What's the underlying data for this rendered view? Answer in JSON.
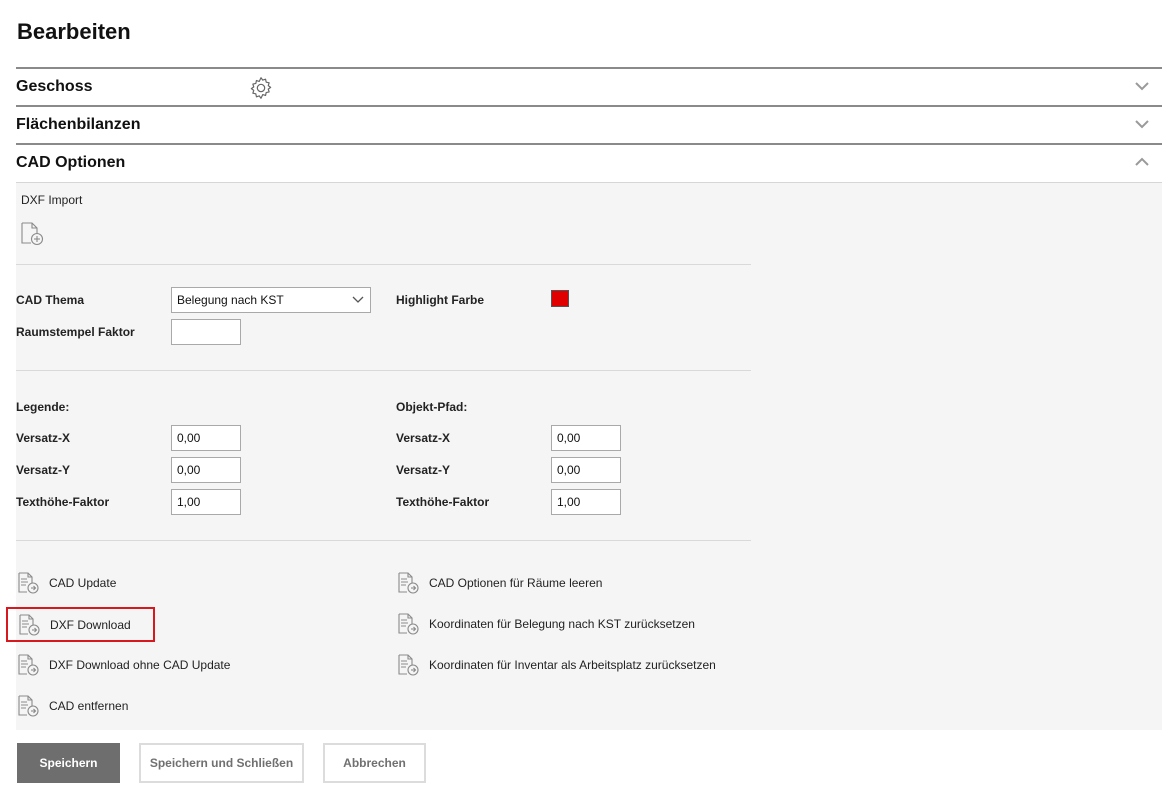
{
  "page": {
    "title": "Bearbeiten"
  },
  "accordion": [
    {
      "title": "Geschoss",
      "expanded": false,
      "icon": "gear-icon"
    },
    {
      "title": "Flächenbilanzen",
      "expanded": false
    },
    {
      "title": "CAD Optionen",
      "expanded": true
    }
  ],
  "cad": {
    "dxf_import_label": "DXF Import",
    "thema_label": "CAD Thema",
    "thema_value": "Belegung nach KST",
    "highlight_label": "Highlight Farbe",
    "highlight_color": "#e00000",
    "raumstempel_label": "Raumstempel Faktor",
    "raumstempel_value": "",
    "legende": {
      "title": "Legende:",
      "versatz_x_label": "Versatz-X",
      "versatz_x": "0,00",
      "versatz_y_label": "Versatz-Y",
      "versatz_y": "0,00",
      "texthoehe_label": "Texthöhe-Faktor",
      "texthoehe": "1,00"
    },
    "objekt": {
      "title": "Objekt-Pfad:",
      "versatz_x_label": "Versatz-X",
      "versatz_x": "0,00",
      "versatz_y_label": "Versatz-Y",
      "versatz_y": "0,00",
      "texthoehe_label": "Texthöhe-Faktor",
      "texthoehe": "1,00"
    },
    "actions_left": [
      "CAD Update",
      "DXF Download",
      "DXF Download ohne CAD Update",
      "CAD entfernen"
    ],
    "actions_right": [
      "CAD Optionen für Räume leeren",
      "Koordinaten für Belegung nach KST zurücksetzen",
      "Koordinaten für Inventar als Arbeitsplatz zurücksetzen"
    ]
  },
  "buttons": {
    "save": "Speichern",
    "save_close": "Speichern und Schließen",
    "cancel": "Abbrechen"
  }
}
